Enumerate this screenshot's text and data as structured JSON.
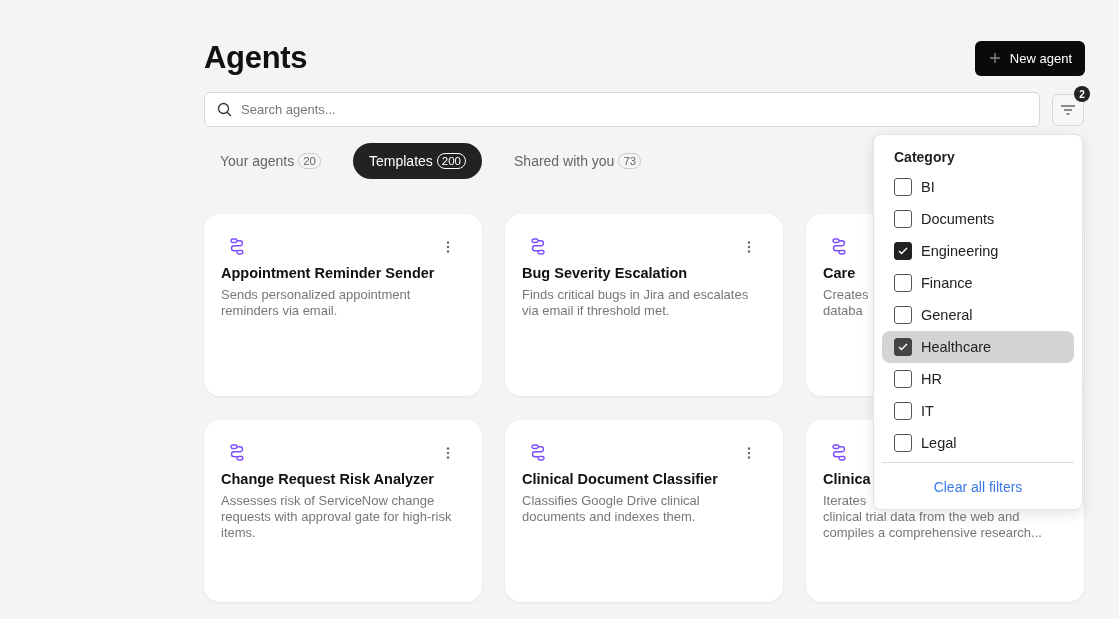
{
  "header": {
    "title": "Agents",
    "new_button": "New agent"
  },
  "search": {
    "placeholder": "Search agents..."
  },
  "filter_button": {
    "badge": "2"
  },
  "tabs": [
    {
      "label": "Your agents",
      "count": "20",
      "selected": false
    },
    {
      "label": "Templates",
      "count": "200",
      "selected": true
    },
    {
      "label": "Shared with you",
      "count": "73",
      "selected": false
    }
  ],
  "cards": [
    {
      "title": "Appointment Reminder Sender",
      "description": "Sends personalized appointment reminders via email."
    },
    {
      "title": "Bug Severity Escalation",
      "description": "Finds critical bugs in Jira and escalates via email if threshold met."
    },
    {
      "title": "Care",
      "description": "Creates\ndataba"
    },
    {
      "title": "Change Request Risk Analyzer",
      "description": "Assesses risk of ServiceNow change requests with approval gate for high-risk items."
    },
    {
      "title": "Clinical Document Classifier",
      "description": "Classifies Google Drive clinical documents and indexes them."
    },
    {
      "title": "Clinica",
      "description": "Iterates\nclinical trial data from the web and\ncompiles a comprehensive research..."
    }
  ],
  "filter_menu": {
    "heading": "Category",
    "options": [
      {
        "label": "BI",
        "checked": false,
        "selected": false
      },
      {
        "label": "Documents",
        "checked": false,
        "selected": false
      },
      {
        "label": "Engineering",
        "checked": true,
        "selected": false
      },
      {
        "label": "Finance",
        "checked": false,
        "selected": false
      },
      {
        "label": "General",
        "checked": false,
        "selected": false
      },
      {
        "label": "Healthcare",
        "checked": true,
        "selected": true
      },
      {
        "label": "HR",
        "checked": false,
        "selected": false
      },
      {
        "label": "IT",
        "checked": false,
        "selected": false
      },
      {
        "label": "Legal",
        "checked": false,
        "selected": false
      }
    ],
    "clear_link": "Clear all filters"
  }
}
